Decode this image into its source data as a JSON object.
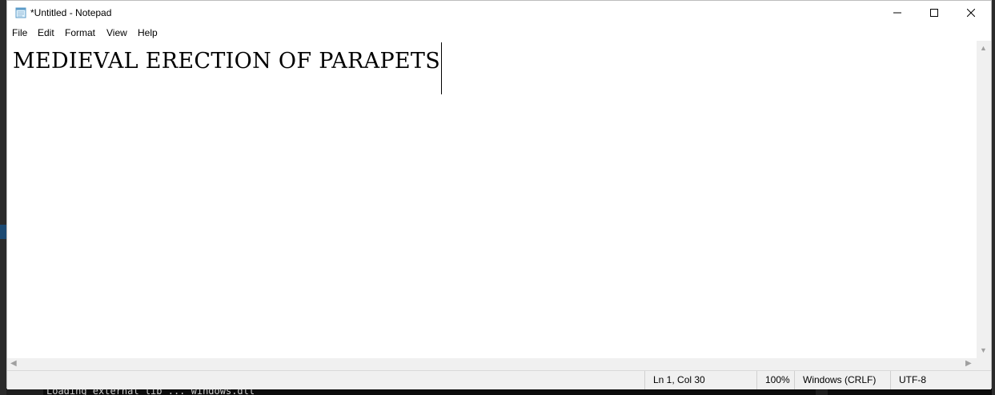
{
  "window": {
    "title": "*Untitled - Notepad"
  },
  "menu": {
    "items": [
      "File",
      "Edit",
      "Format",
      "View",
      "Help"
    ]
  },
  "editor": {
    "content": "MEDIEVAL ERECTION OF PARAPETS"
  },
  "status": {
    "position": "Ln 1, Col 30",
    "zoom": "100%",
    "line_ending": "Windows (CRLF)",
    "encoding": "UTF-8"
  },
  "background": {
    "terminal_text": "Loading external lib ... windows.dll"
  },
  "icons": {
    "app": "notepad-icon",
    "minimize": "minimize-icon",
    "maximize": "maximize-icon",
    "close": "close-icon"
  },
  "colors": {
    "window_bg": "#ffffff",
    "chrome_bg": "#f0f0f0",
    "desktop_bg": "#1e1e1e"
  }
}
